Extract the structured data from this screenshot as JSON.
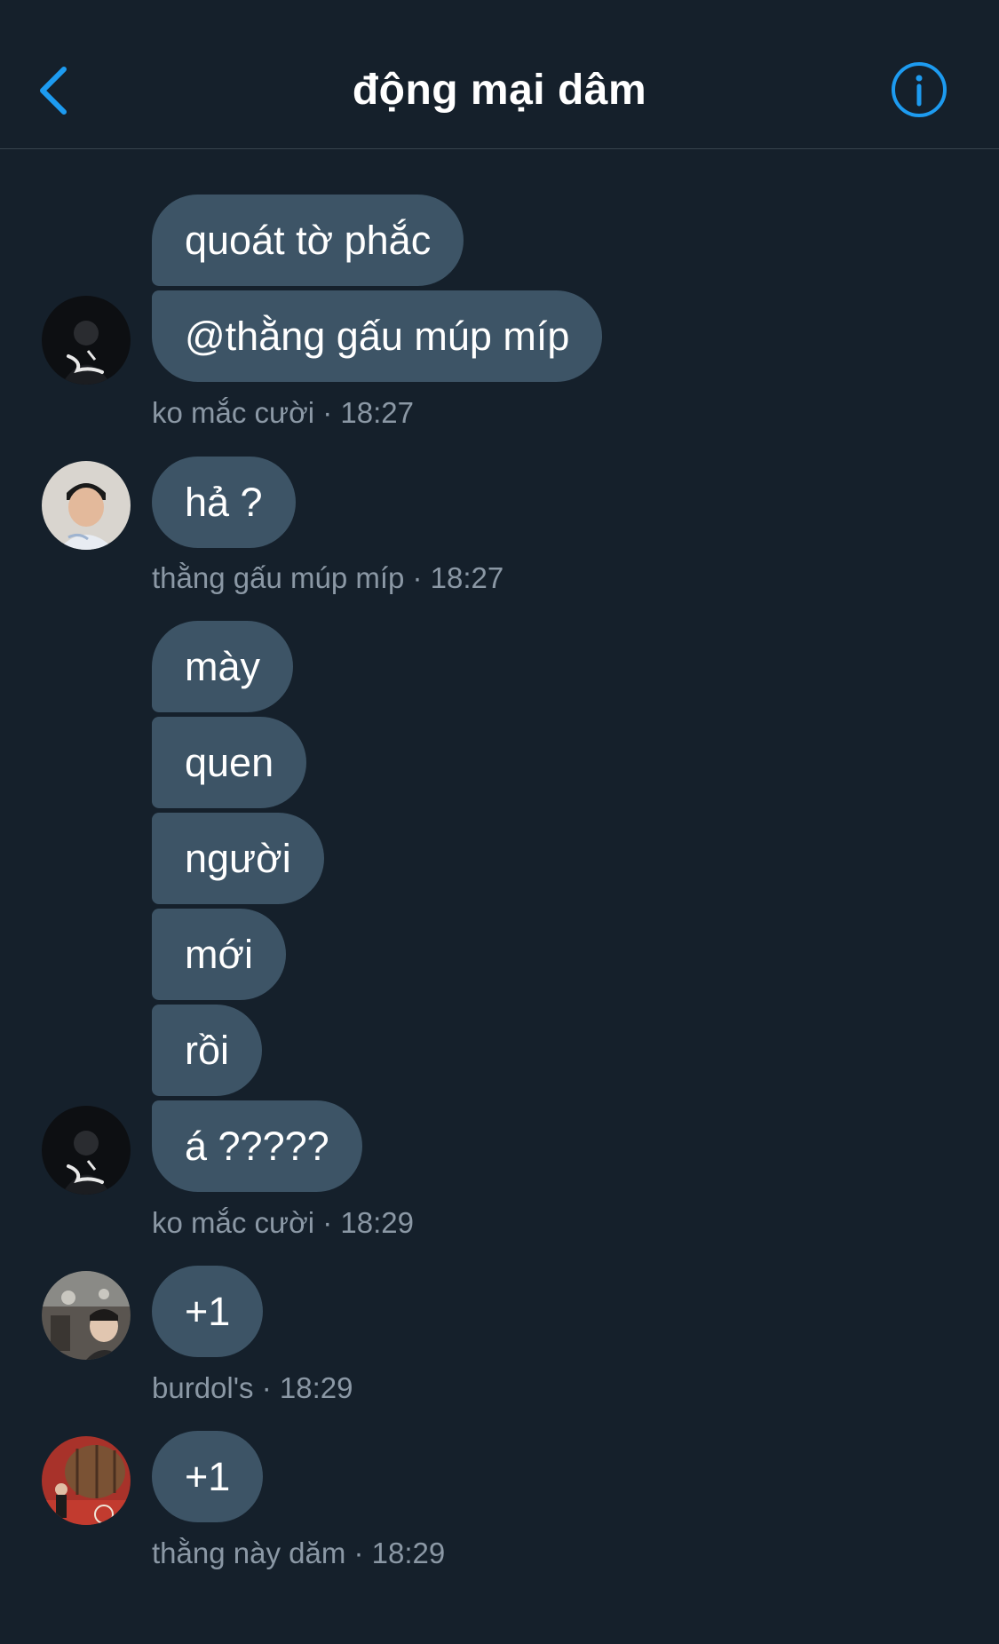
{
  "header": {
    "title": "động mại dâm",
    "back_icon": "chevron-left-icon",
    "info_icon": "info-circle-icon",
    "accent_color": "#1d9bf0"
  },
  "messages": [
    {
      "text": "quoát tờ phắc"
    },
    {
      "text": "@thằng gấu múp míp"
    },
    {
      "meta": "ko mắc cười · 18:27"
    },
    {
      "text": "hả ?"
    },
    {
      "meta": "thằng gấu múp míp · 18:27"
    },
    {
      "text": "mày"
    },
    {
      "text": "quen"
    },
    {
      "text": "người"
    },
    {
      "text": "mới"
    },
    {
      "text": "rồi"
    },
    {
      "text": "á ?????"
    },
    {
      "meta": "ko mắc cười · 18:29"
    },
    {
      "text": "+1"
    },
    {
      "meta": "burdol's · 18:29"
    },
    {
      "text": "+1"
    },
    {
      "meta": "thằng này dăm · 18:29"
    }
  ],
  "colors": {
    "background": "#15202b",
    "bubble": "#3d5466",
    "meta_text": "#8b98a5",
    "divider": "#38444d"
  }
}
